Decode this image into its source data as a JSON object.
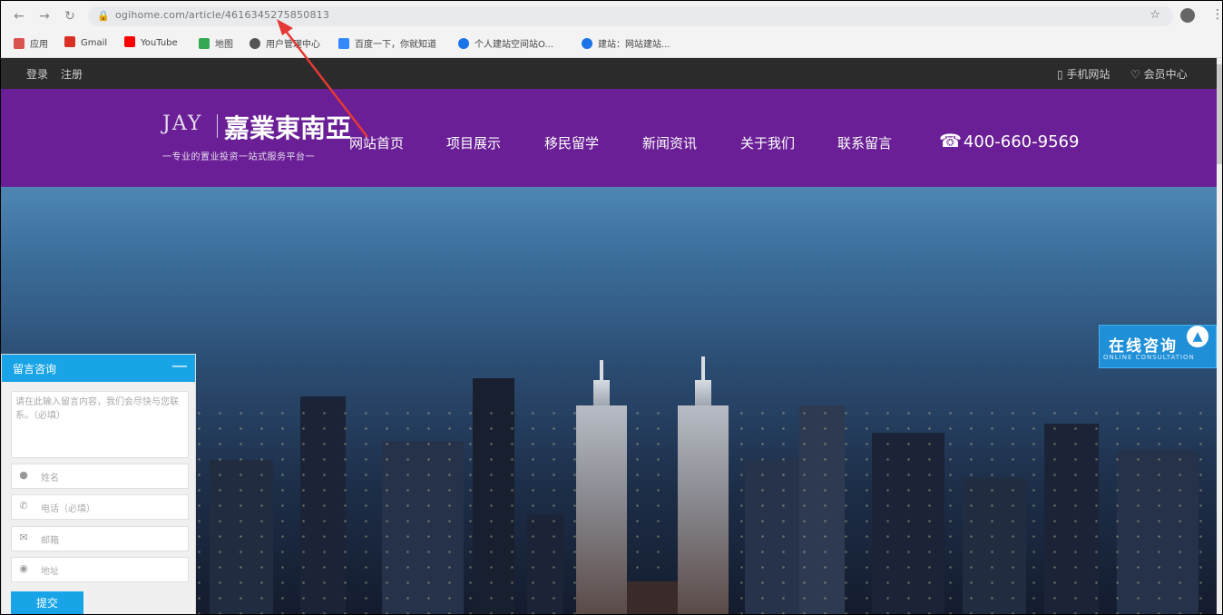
{
  "browser": {
    "url": "ogihome.com/article/4616345275850813",
    "bookmarks": [
      {
        "label": "应用",
        "color": "#d9534f"
      },
      {
        "label": "Gmail",
        "color": "#d93025"
      },
      {
        "label": "YouTube",
        "color": "#ff0000"
      },
      {
        "label": "地图",
        "color": "#34a853"
      },
      {
        "label": "用户管理中心",
        "color": "#555555"
      },
      {
        "label": "百度一下，你就知道",
        "color": "#3388ff"
      },
      {
        "label": "个人建站空间站O...",
        "color": "#1a73e8"
      },
      {
        "label": "建站：网站建站...",
        "color": "#1a73e8"
      }
    ]
  },
  "topbar": {
    "login": "登录",
    "register": "注册",
    "mobile": "手机网站",
    "member": "会员中心"
  },
  "header": {
    "logo_en": "JAY",
    "logo_cn": "嘉業東南亞",
    "logo_tagline": "一专业的置业投资一站式服务平台一",
    "nav": [
      "网站首页",
      "项目展示",
      "移民留学",
      "新闻资讯",
      "关于我们",
      "联系留言"
    ],
    "phone": "400-660-9569"
  },
  "consult_form": {
    "title": "留言咨询",
    "message_placeholder": "请在此输入留言内容，我们会尽快与您联系。（必填）",
    "name_placeholder": "姓名",
    "phone_placeholder": "电话（必填）",
    "email_placeholder": "邮箱",
    "address_placeholder": "地址",
    "submit": "提交"
  },
  "online_consult": {
    "title": "在线咨询",
    "subtitle": "ONLINE CONSULTATION"
  },
  "colors": {
    "header_purple": "#6a1f96",
    "accent_blue": "#18a4e6",
    "annotation_red": "#e53935"
  }
}
